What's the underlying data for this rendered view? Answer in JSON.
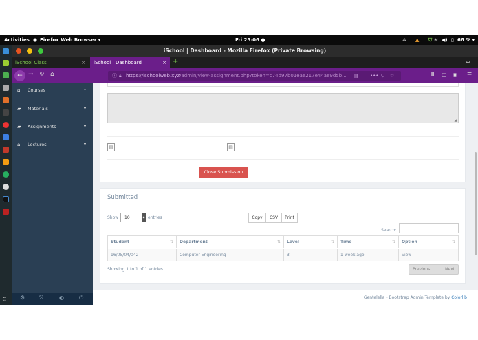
{
  "gnome": {
    "activities": "Activities",
    "app_menu": "Firefox Web Browser ▾",
    "clock": "Fri 23:06 ●",
    "battery": "66 % ▾"
  },
  "window": {
    "title": "iSchool | Dashboard - Mozilla Firefox (Private Browsing)"
  },
  "tabs": [
    {
      "label": "iSchool Class",
      "close": "×"
    },
    {
      "label": "iSchool | Dashboard",
      "close": "×"
    }
  ],
  "new_tab": "+",
  "url": {
    "host": "https://ischoolweb.xyz",
    "path": "/admin/view-assignment.php?token=c74d97b01eae217e44ae9d5b..."
  },
  "sidebar": {
    "items": [
      {
        "label": "Courses"
      },
      {
        "label": "Materials"
      },
      {
        "label": "Assignments"
      },
      {
        "label": "Lectures"
      }
    ]
  },
  "submission": {
    "close_button": "Close Submission"
  },
  "submitted": {
    "title": "Submitted",
    "show_label": "Show",
    "entries_value": "10",
    "entries_label": "entries",
    "export_buttons": [
      "Copy",
      "CSV",
      "Print"
    ],
    "search_label": "Search:",
    "columns": [
      "Student",
      "Department",
      "Level",
      "Time",
      "Option"
    ],
    "rows": [
      [
        "16/05/04/042",
        "Computer Engineering",
        "3",
        "1 week ago",
        "View"
      ]
    ],
    "info": "Showing 1 to 1 of 1 entries",
    "prev": "Previous",
    "next": "Next"
  },
  "footer": {
    "text": "Gentelella - Bootstrap Admin Template by ",
    "link": "Colorlib"
  },
  "colors": {
    "toolbar": "#6b1e8a",
    "sidebar": "#2a3f54",
    "close_button": "#d9534f",
    "tab_active": "#6b1e8a"
  }
}
